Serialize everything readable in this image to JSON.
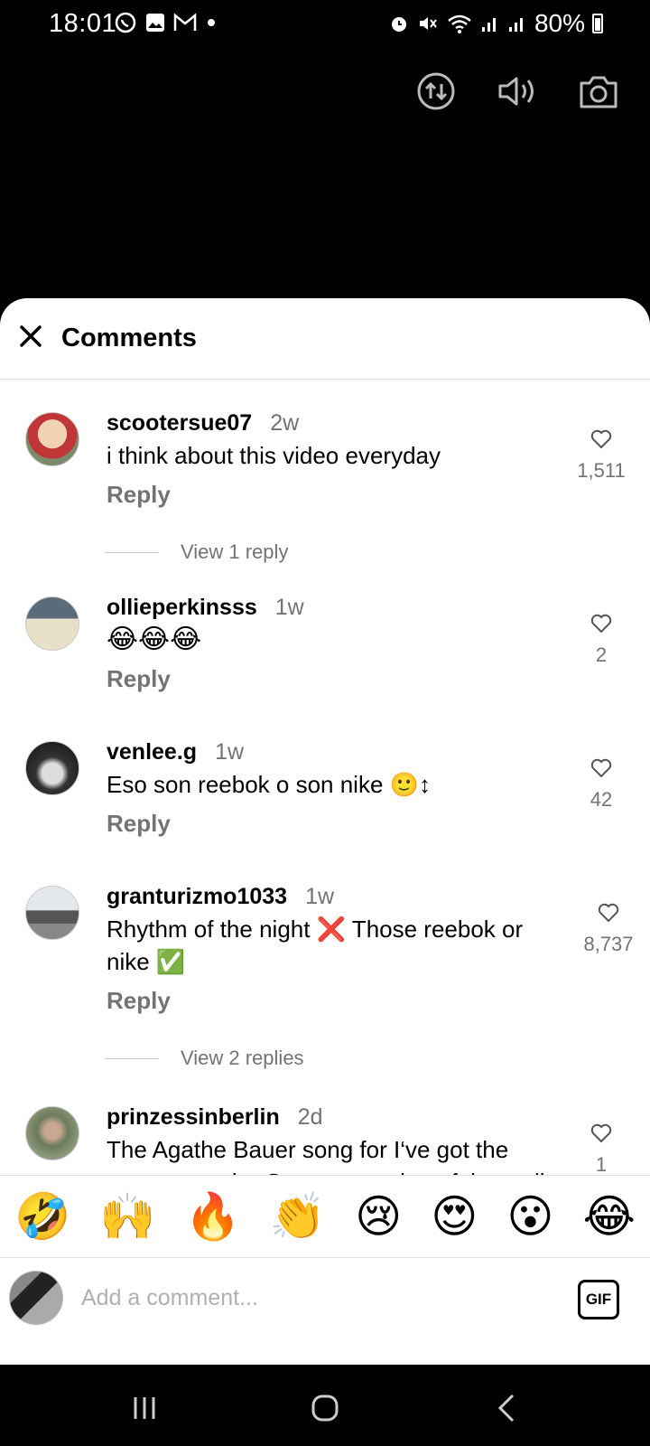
{
  "status_bar": {
    "time": "18:01",
    "battery": "80%"
  },
  "sheet": {
    "title": "Comments"
  },
  "comments": [
    {
      "username": "scootersue07",
      "time": "2w",
      "text": "i think about this video everyday",
      "reply_label": "Reply",
      "likes": "1,511",
      "view_replies": "View 1 reply"
    },
    {
      "username": "ollieperkinsss",
      "time": "1w",
      "text": "😂😂😂",
      "reply_label": "Reply",
      "likes": "2"
    },
    {
      "username": "venlee.g",
      "time": "1w",
      "text": "Eso son reebok o son nike 🙂↕",
      "reply_label": "Reply",
      "likes": "42"
    },
    {
      "username": "granturizmo1033",
      "time": "1w",
      "text": "Rhythm of the night ❌ Those reebok or nike ✅",
      "reply_label": "Reply",
      "likes": "8,737",
      "view_replies": "View 2 replies"
    },
    {
      "username": "prinzessinberlin",
      "time": "2d",
      "text": "The Agathe Bauer song for I‘ve got the power was the German version of that call",
      "likes": "1"
    }
  ],
  "emoji_bar": [
    "🤣",
    "🙌",
    "🔥",
    "👏",
    "😢",
    "😍",
    "😮",
    "😂"
  ],
  "input": {
    "placeholder": "Add a comment...",
    "gif_label": "GIF"
  }
}
